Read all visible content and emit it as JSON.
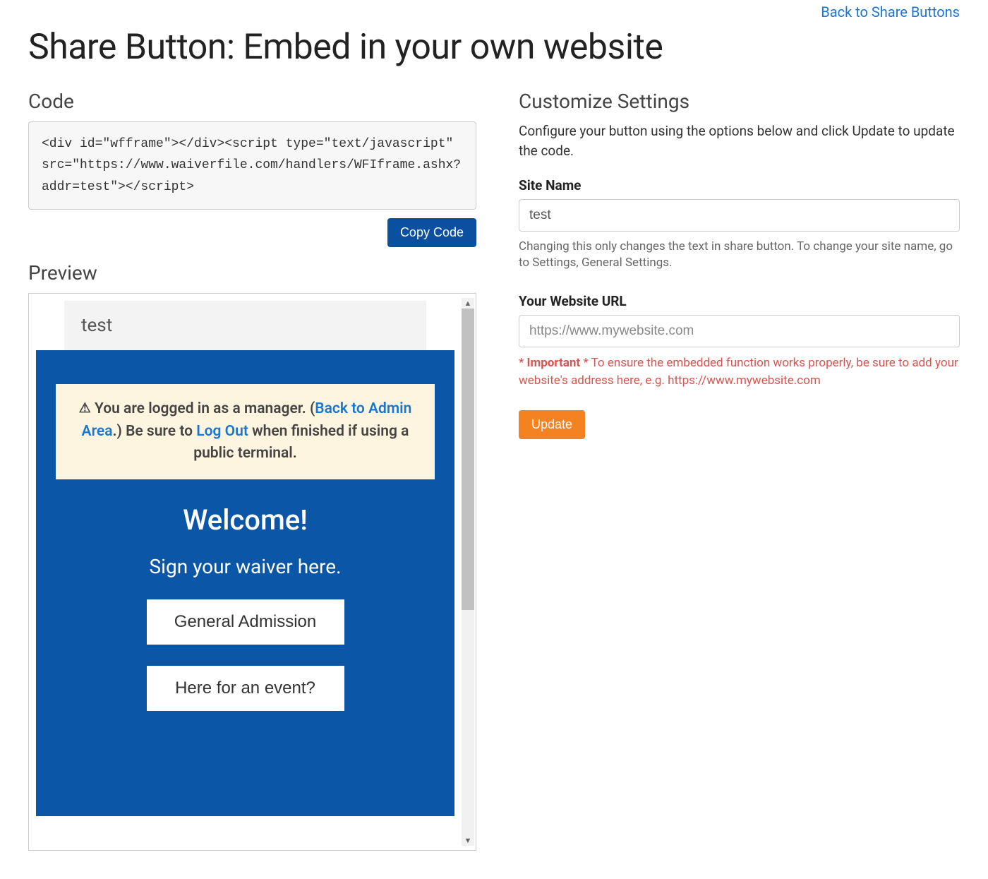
{
  "topLink": "Back to Share Buttons",
  "pageTitle": "Share Button: Embed in your own website",
  "code": {
    "heading": "Code",
    "content": "<div id=\"wfframe\"></div><script type=\"text/javascript\" src=\"https://www.waiverfile.com/handlers/WFIframe.ashx?addr=test\"></script>",
    "copyLabel": "Copy Code"
  },
  "preview": {
    "heading": "Preview",
    "siteHeader": "test",
    "alert": {
      "prefix": "You are logged in as a manager. (",
      "linkBack": "Back to Admin Area",
      "mid1": ".) Be sure to ",
      "linkLogout": "Log Out",
      "mid2": " when finished if using a public terminal."
    },
    "welcome": "Welcome!",
    "sub": "Sign your waiver here.",
    "btn1": "General Admission",
    "btn2": "Here for an event?"
  },
  "settings": {
    "heading": "Customize Settings",
    "help": "Configure your button using the options below and click Update to update the code.",
    "siteName": {
      "label": "Site Name",
      "value": "test",
      "hint": "Changing this only changes the text in share button. To change your site name, go to Settings, General Settings."
    },
    "url": {
      "label": "Your Website URL",
      "placeholder": "https://www.mywebsite.com",
      "importantPrefix": "* ",
      "importantWord": "Important",
      "importantSuffix": " * To ensure the embedded function works properly, be sure to add your website's address here, e.g. https://www.mywebsite.com"
    },
    "updateLabel": "Update"
  }
}
